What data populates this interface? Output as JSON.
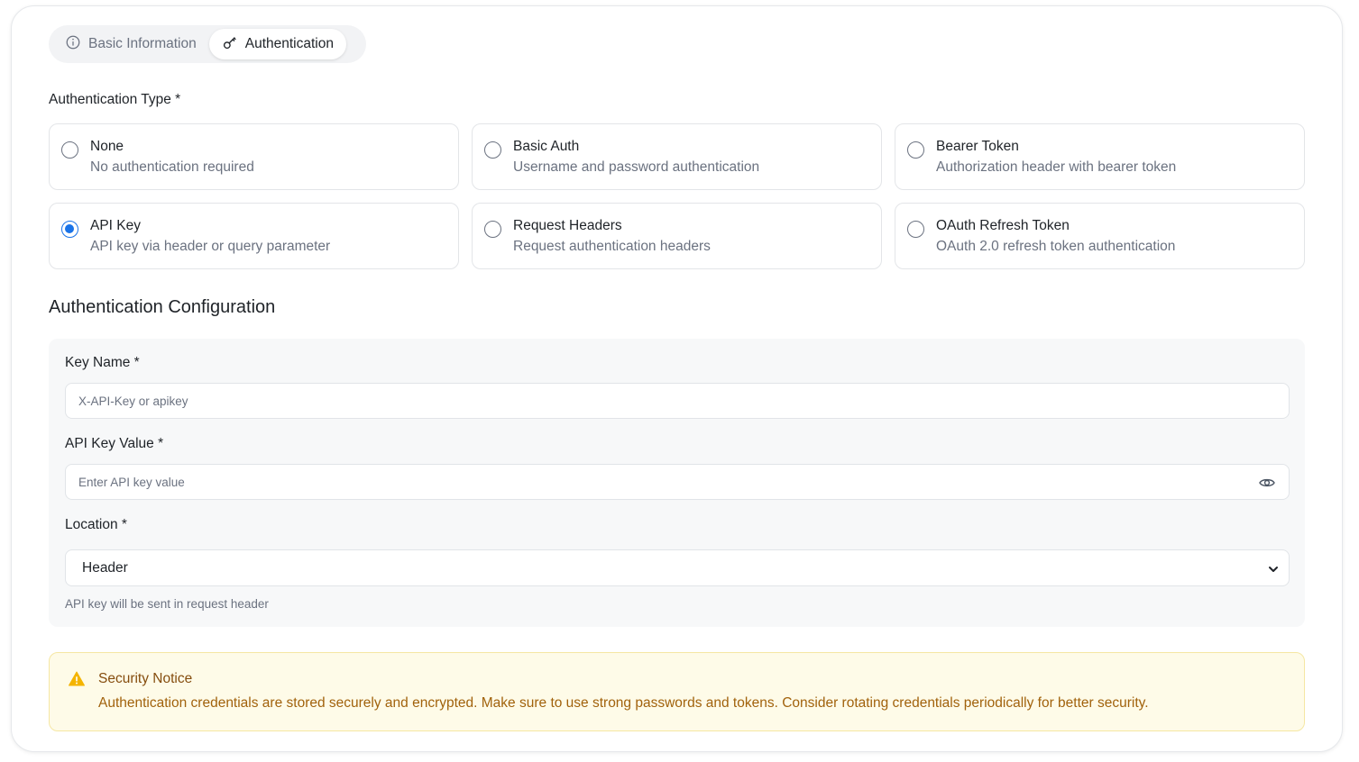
{
  "tabs": {
    "basic_information": "Basic Information",
    "authentication": "Authentication",
    "active": "authentication"
  },
  "auth_type": {
    "label": "Authentication Type *",
    "selected": "api_key",
    "options": [
      {
        "title": "None",
        "description": "No authentication required"
      },
      {
        "title": "Basic Auth",
        "description": "Username and password authentication"
      },
      {
        "title": "Bearer Token",
        "description": "Authorization header with bearer token"
      },
      {
        "title": "API Key",
        "description": "API key via header or query parameter"
      },
      {
        "title": "Request Headers",
        "description": "Request authentication headers"
      },
      {
        "title": "OAuth Refresh Token",
        "description": "OAuth 2.0 refresh token authentication"
      }
    ]
  },
  "config": {
    "heading": "Authentication Configuration",
    "key_name_label": "Key Name *",
    "key_name_placeholder": "X-API-Key or apikey",
    "key_value_label": "API Key Value *",
    "key_value_placeholder": "Enter API key value",
    "location_label": "Location *",
    "location_value": "Header",
    "location_help": "API key will be sent in request header"
  },
  "notice": {
    "title": "Security Notice",
    "text": "Authentication credentials are stored securely and encrypted. Make sure to use strong passwords and tokens. Consider rotating credentials periodically for better security."
  },
  "colors": {
    "accent": "#1a73e8",
    "notice_bg": "#fefbe8",
    "notice_text": "#a1620c",
    "warning_icon": "#f4b400"
  },
  "icons": {
    "basic_information": "info-icon",
    "authentication": "key-icon",
    "reveal": "eye-icon",
    "location_dropdown": "chevron-down-icon",
    "notice": "warning-icon"
  }
}
